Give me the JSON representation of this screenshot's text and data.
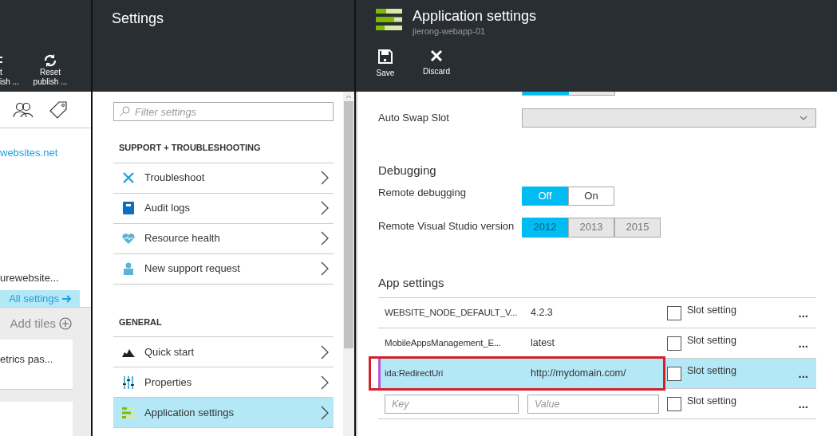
{
  "left_blade": {
    "toolbar": [
      {
        "lines": [
          "t",
          "ish ..."
        ]
      },
      {
        "lines": [
          "Reset",
          "publish ..."
        ]
      }
    ],
    "url_link": "websites.net",
    "host_text": "urewebsite...",
    "all_settings": "All settings",
    "add_tiles": "Add tiles",
    "tile_text": "etrics pas..."
  },
  "settings_blade": {
    "title": "Settings",
    "filter": {
      "placeholder": "Filter settings"
    },
    "sections": [
      {
        "heading": "SUPPORT + TROUBLESHOOTING",
        "items": [
          {
            "label": "Troubleshoot",
            "selected": false
          },
          {
            "label": "Audit logs",
            "selected": false
          },
          {
            "label": "Resource health",
            "selected": false
          },
          {
            "label": "New support request",
            "selected": false
          }
        ]
      },
      {
        "heading": "GENERAL",
        "items": [
          {
            "label": "Quick start",
            "selected": false
          },
          {
            "label": "Properties",
            "selected": false
          },
          {
            "label": "Application settings",
            "selected": true
          }
        ]
      }
    ]
  },
  "app_blade": {
    "title": "Application settings",
    "subtitle": "jierong-webapp-01",
    "commands": [
      {
        "label": "Save"
      },
      {
        "label": "Discard"
      }
    ],
    "cut_toggle": [
      {
        "selected": true
      },
      {
        "selected": false
      }
    ],
    "auto_swap": {
      "label": "Auto Swap Slot"
    },
    "debugging": {
      "heading": "Debugging",
      "remote_debugging": {
        "label": "Remote debugging",
        "options": [
          {
            "label": "Off",
            "selected": true
          },
          {
            "label": "On",
            "selected": false
          }
        ]
      },
      "vs_version": {
        "label": "Remote Visual Studio version",
        "disabled": true,
        "options": [
          {
            "label": "2012",
            "selected": true
          },
          {
            "label": "2013",
            "selected": false
          },
          {
            "label": "2015",
            "selected": false
          }
        ]
      }
    },
    "app_settings": {
      "heading": "App settings",
      "rows": [
        {
          "key": "WEBSITE_NODE_DEFAULT_V...",
          "value": "4.2.3",
          "slot_label": "Slot setting",
          "checked": false,
          "selected": false,
          "outlined": false,
          "more": "..."
        },
        {
          "key": "MobileAppsManagement_E...",
          "value": "latest",
          "slot_label": "Slot setting",
          "checked": false,
          "selected": false,
          "outlined": false,
          "more": "..."
        },
        {
          "key": "ida:RedirectUri",
          "value": "http://mydomain.com/",
          "slot_label": "Slot setting",
          "checked": false,
          "selected": true,
          "outlined": true,
          "more": "..."
        }
      ],
      "new_row": {
        "key_placeholder": "Key",
        "value_placeholder": "Value",
        "slot_label": "Slot setting",
        "checked": false,
        "more": "..."
      }
    }
  }
}
